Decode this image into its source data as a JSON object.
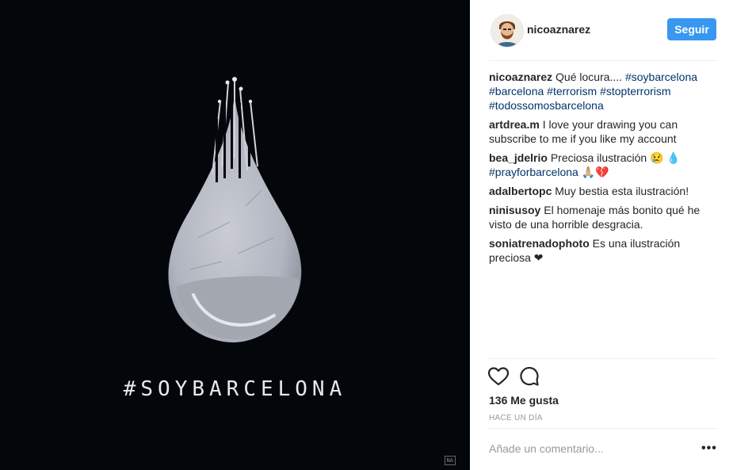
{
  "post": {
    "image_hashtag": "#SOYBARCELONA",
    "signature": "NA"
  },
  "header": {
    "username": "nicoaznarez",
    "follow_label": "Seguir"
  },
  "caption": {
    "author": "nicoaznarez",
    "text": "Qué locura....",
    "tags": [
      "#soybarcelona",
      "#barcelona",
      "#terrorism",
      "#stopterrorism",
      "#todossomosbarcelona"
    ]
  },
  "comments": [
    {
      "author": "artdrea.m",
      "text": "I love your drawing you can subscribe to me if you like my account"
    },
    {
      "author": "bea_jdelrio",
      "text": "Preciosa ilustración 😢 💧",
      "tag": "#prayforbarcelona",
      "after_tag": "🙏🏼💔"
    },
    {
      "author": "adalbertopc",
      "text": "Muy bestia esta ilustración!"
    },
    {
      "author": "ninisusoy",
      "text": "El homenaje más bonito qué he visto de una horrible desgracia."
    },
    {
      "author": "soniatrenadophoto",
      "text": "Es una ilustración preciosa ❤"
    }
  ],
  "stats": {
    "likes": "136 Me gusta",
    "time": "HACE UN DÍA"
  },
  "add_comment": {
    "placeholder": "Añade un comentario..."
  },
  "icons": {
    "like": "heart-icon",
    "comment": "comment-icon",
    "more": "more-options-icon"
  },
  "colors": {
    "accent": "#3897f0",
    "hashtag": "#003569",
    "image_bg": "#03070c"
  }
}
